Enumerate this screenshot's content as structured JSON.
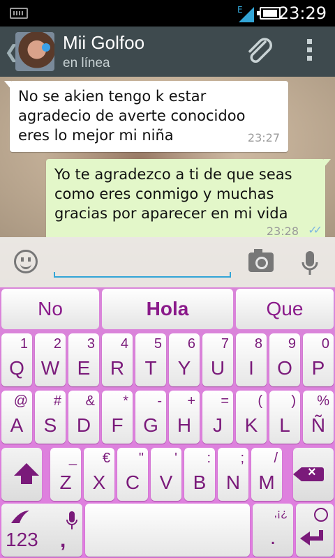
{
  "status_bar": {
    "network_label": "E",
    "time": "23:29"
  },
  "action_bar": {
    "contact_name": "Mii Golfoo",
    "contact_status": "en línea"
  },
  "messages": [
    {
      "direction": "incoming",
      "lines": [
        "No se akien tengo k estar",
        "agradecio de averte conocidoo",
        "eres  lo mejor  mi niña"
      ],
      "time": "23:27"
    },
    {
      "direction": "outgoing",
      "lines": [
        "Yo te agradezco a ti de que seas",
        "como eres conmigo y muchas",
        "gracias por aparecer en mi vida"
      ],
      "time": "23:28"
    }
  ],
  "compose": {
    "value": "",
    "placeholder": ""
  },
  "keyboard": {
    "suggestions": [
      "No",
      "Hola",
      "Que"
    ],
    "row1": [
      {
        "main": "Q",
        "sub": "1"
      },
      {
        "main": "W",
        "sub": "2"
      },
      {
        "main": "E",
        "sub": "3"
      },
      {
        "main": "R",
        "sub": "4"
      },
      {
        "main": "T",
        "sub": "5"
      },
      {
        "main": "Y",
        "sub": "6"
      },
      {
        "main": "U",
        "sub": "7"
      },
      {
        "main": "I",
        "sub": "8"
      },
      {
        "main": "O",
        "sub": "9"
      },
      {
        "main": "P",
        "sub": "0"
      }
    ],
    "row2": [
      {
        "main": "A",
        "sub": "@"
      },
      {
        "main": "S",
        "sub": "#"
      },
      {
        "main": "D",
        "sub": "&"
      },
      {
        "main": "F",
        "sub": "*"
      },
      {
        "main": "G",
        "sub": "-"
      },
      {
        "main": "H",
        "sub": "+"
      },
      {
        "main": "J",
        "sub": "="
      },
      {
        "main": "K",
        "sub": "("
      },
      {
        "main": "L",
        "sub": ")"
      },
      {
        "main": "Ñ",
        "sub": "%"
      }
    ],
    "row3": [
      {
        "main": "Z",
        "sub": "_"
      },
      {
        "main": "X",
        "sub": "€"
      },
      {
        "main": "C",
        "sub": "\""
      },
      {
        "main": "V",
        "sub": "'"
      },
      {
        "main": "B",
        "sub": ":"
      },
      {
        "main": "N",
        "sub": ";"
      },
      {
        "main": "M",
        "sub": "/"
      }
    ],
    "numbers_label": "123",
    "comma_label": ",",
    "period_label": ".",
    "period_sub": ",¡¿",
    "theme_color": "#d985d9",
    "key_text_color": "#7a1a7a"
  },
  "colors": {
    "action_bar": "#3e4a4e",
    "outgoing_bubble": "#e3f7c9",
    "input_underline": "#33a5d6"
  }
}
